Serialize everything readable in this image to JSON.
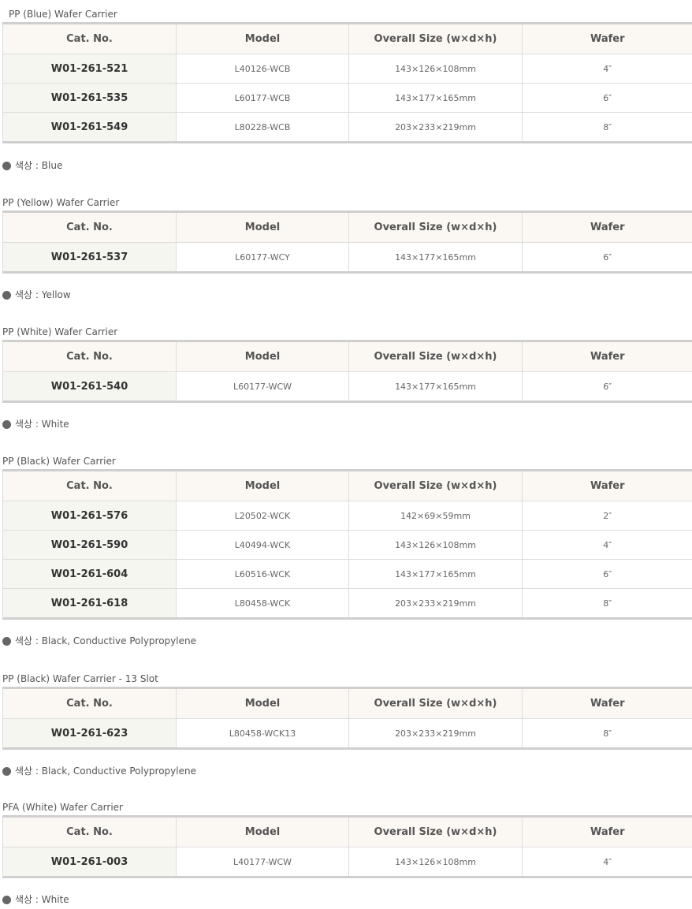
{
  "headers": {
    "cat_no": "Cat. No.",
    "model": "Model",
    "size": "Overall Size (w×d×h)",
    "wafer": "Wafer"
  },
  "note_prefix": "색상 : ",
  "sections": [
    {
      "title": "PP (Blue) Wafer Carrier",
      "rows": [
        {
          "cat": "W01-261-521",
          "model": "L40126-WCB",
          "size": "143×126×108mm",
          "wafer": "4″"
        },
        {
          "cat": "W01-261-535",
          "model": "L60177-WCB",
          "size": "143×177×165mm",
          "wafer": "6″"
        },
        {
          "cat": "W01-261-549",
          "model": "L80228-WCB",
          "size": "203×233×219mm",
          "wafer": "8″"
        }
      ],
      "note": "Blue"
    },
    {
      "title": "PP (Yellow) Wafer Carrier",
      "rows": [
        {
          "cat": "W01-261-537",
          "model": "L60177-WCY",
          "size": "143×177×165mm",
          "wafer": "6″"
        }
      ],
      "note": "Yellow"
    },
    {
      "title": "PP (White) Wafer Carrier",
      "rows": [
        {
          "cat": "W01-261-540",
          "model": "L60177-WCW",
          "size": "143×177×165mm",
          "wafer": "6″"
        }
      ],
      "note": "White"
    },
    {
      "title": "PP (Black) Wafer Carrier",
      "rows": [
        {
          "cat": "W01-261-576",
          "model": "L20502-WCK",
          "size": "142×69×59mm",
          "wafer": "2″"
        },
        {
          "cat": "W01-261-590",
          "model": "L40494-WCK",
          "size": "143×126×108mm",
          "wafer": "4″"
        },
        {
          "cat": "W01-261-604",
          "model": "L60516-WCK",
          "size": "143×177×165mm",
          "wafer": "6″"
        },
        {
          "cat": "W01-261-618",
          "model": "L80458-WCK",
          "size": "203×233×219mm",
          "wafer": "8″"
        }
      ],
      "note": "Black, Conductive Polypropylene"
    },
    {
      "title": "PP (Black) Wafer Carrier - 13 Slot",
      "rows": [
        {
          "cat": "W01-261-623",
          "model": "L80458-WCK13",
          "size": "203×233×219mm",
          "wafer": "8″"
        }
      ],
      "note": "Black, Conductive Polypropylene"
    },
    {
      "title": "PFA (White) Wafer Carrier",
      "rows": [
        {
          "cat": "W01-261-003",
          "model": "L40177-WCW",
          "size": "143×126×108mm",
          "wafer": "4″"
        }
      ],
      "note": "White"
    }
  ]
}
